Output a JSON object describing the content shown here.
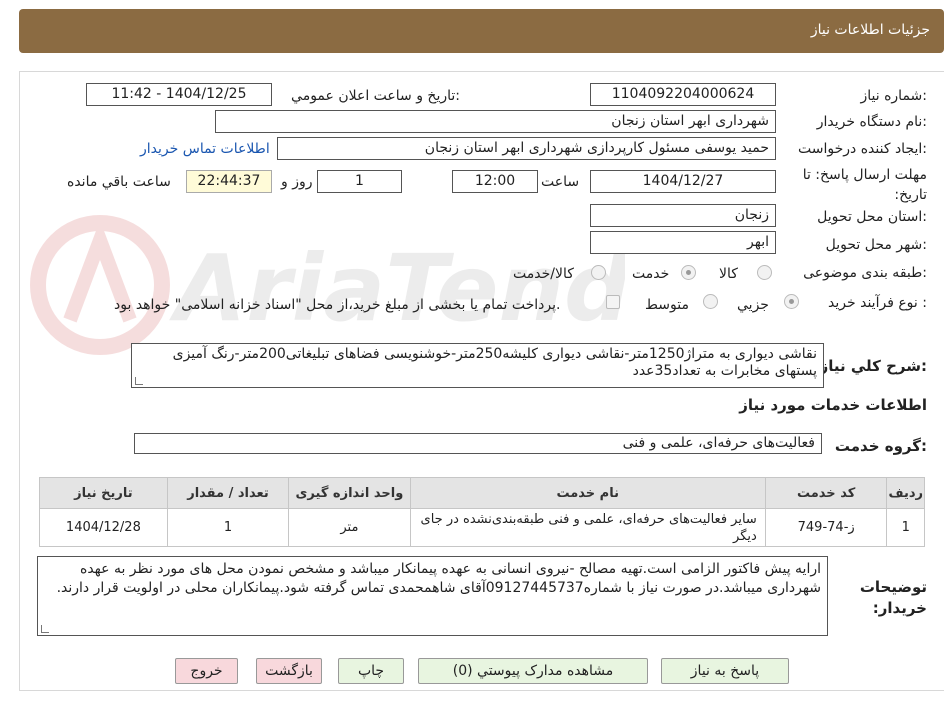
{
  "header": {
    "title": "جزئیات اطلاعات نیاز"
  },
  "form": {
    "need_number_label": "شماره نیاز:",
    "need_number": "1104092204000624",
    "announce_label": "تاریخ و ساعت اعلان عمومي:",
    "announce_value": "1404/12/25 - 11:42",
    "buyer_org_label": "نام دستگاه خريدار:",
    "buyer_org": "شهرداری ابهر استان زنجان",
    "requester_label": "ايجاد کننده درخواست:",
    "requester": "حمید یوسفی مسئول کارپردازی شهرداری ابهر استان زنجان",
    "contact_link": "اطلاعات تماس خريدار",
    "deadline_label": "مهلت ارسال پاسخ: تا تاريخ:",
    "deadline_date": "1404/12/27",
    "time_label": "ساعت",
    "deadline_time": "12:00",
    "days_value": "1",
    "days_label": "روز و",
    "remaining_time": "22:44:37",
    "remaining_label": "ساعت باقي مانده",
    "province_label": "استان محل تحويل:",
    "province": "زنجان",
    "city_label": "شهر محل تحويل:",
    "city": "ابهر",
    "category_label": "طبقه بندی موضوعی:",
    "category_options": [
      "کالا",
      "خدمت",
      "کالا/خدمت"
    ],
    "process_label": "نوع فرآيند خريد :",
    "process_options": [
      "جزيي",
      "متوسط"
    ],
    "payment_note": "پرداخت تمام یا بخشی از مبلغ خرید،از محل \"اسناد خزانه اسلامی\" خواهد بود.",
    "summary_label": "شرح كلي نياز:",
    "summary": "نقاشی دیواری به متراژ1250متر-نقاشی دیواری کلیشه250متر-خوشنویسی فضاهای تبلیغاتی200متر-رنگ آمیزی پستهای مخابرات به تعداد35عدد"
  },
  "services": {
    "section_title": "اطلاعات خدمات مورد نياز",
    "group_label": "گروه خدمت:",
    "group_value": "فعالیت‌های حرفه‌ای، علمی و فنی",
    "columns": [
      "رديف",
      "کد خدمت",
      "نام خدمت",
      "واحد اندازه گيری",
      "تعداد / مقدار",
      "تاريخ نياز"
    ],
    "rows": [
      [
        "1",
        "ز-74-749",
        "سایر فعالیت‌های حرفه‌ای، علمی و فنی طبقه‌بندی‌نشده در جای دیگر",
        "متر",
        "1",
        "1404/12/28"
      ]
    ]
  },
  "buyer_notes": {
    "label": "توضيحات خريدار:",
    "text": "ارایه پیش فاکتور الزامی است.تهیه مصالح -نیروی انسانی به عهده پیمانکار میباشد و مشخص نمودن محل های مورد نظر به عهده شهرداری میباشد.در صورت نیاز با شماره09127445737آقای شاهمحمدی تماس گرفته شود.پیمانکاران محلی در اولویت قرار دارند."
  },
  "buttons": {
    "reply": "پاسخ به نياز",
    "attachments": "مشاهده مدارک پيوستي (0)",
    "print": "چاپ",
    "back": "بازگشت",
    "exit": "خروج"
  },
  "colors": {
    "header_bg": "#8b6b42",
    "button_bg": "#e8f5e0",
    "button_danger_bg": "#f8d8dc",
    "link": "#1a56b0"
  },
  "icons": {
    "watermark": "ariatender-watermark-logo"
  }
}
